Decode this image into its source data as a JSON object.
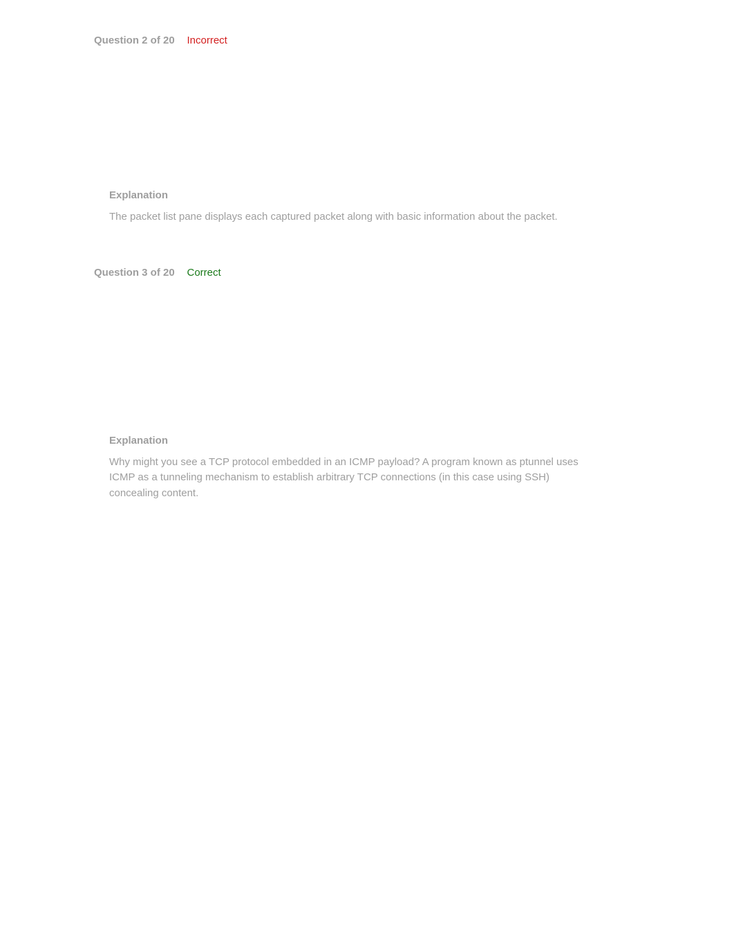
{
  "questions": [
    {
      "header": "Question 2 of 20",
      "status": "Incorrect",
      "explanation_label": "Explanation",
      "explanation_text": "The packet list pane displays each captured packet along with basic information about the packet."
    },
    {
      "header": "Question 3 of 20",
      "status": "Correct",
      "explanation_label": "Explanation",
      "explanation_text": "Why might you see a TCP protocol embedded in an ICMP payload? A program known as ptunnel uses ICMP as a tunneling mechanism to establish arbitrary TCP connections (in this case using SSH) concealing content."
    }
  ]
}
